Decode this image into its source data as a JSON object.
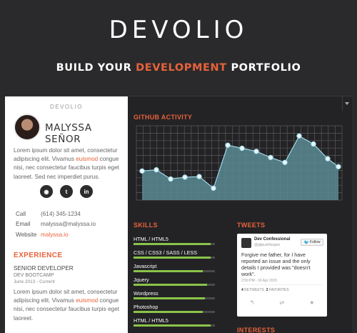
{
  "hero": {
    "title": "DEVOLIO",
    "subtitle_pre": "BUILD YOUR",
    "subtitle_accent": "DEVELOPMENT",
    "subtitle_post": "PORTFOLIO"
  },
  "profile": {
    "brand": "DEVOLIO",
    "name": "MALYSSA SEÑOR",
    "bio_pre": "Lorem ipsum dolor sit amet, consectetur adipiscing elit. Vivamus",
    "bio_highlight": "euismod",
    "bio_post": "congue nisi, nec consectetur faucibus turpis eget laoreet. Sed nec imperdiet purus.",
    "socials": [
      {
        "icon": "github-icon",
        "glyph": "◉"
      },
      {
        "icon": "twitter-icon",
        "glyph": "t"
      },
      {
        "icon": "linkedin-icon",
        "glyph": "in"
      }
    ],
    "contact": {
      "call_label": "Call",
      "call_value": "(614) 345-1234",
      "email_label": "Email",
      "email_value": "malyssa@malyssa.io",
      "website_label": "Website",
      "website_value": "malyssa.io"
    }
  },
  "experience": {
    "heading": "EXPERIENCE",
    "title": "SENIOR DEVELOPER",
    "company": "DEV BOOTCAMP",
    "date": "June 2013 - Current",
    "desc_pre": "Lorem ipsum dolor sit amet, consectetur adipiscing elit. Vivamus",
    "desc_highlight": "euismod",
    "desc_post": "congue nisi, nec consectetur faucibus turpis eget laoreet."
  },
  "github": {
    "heading": "GITHUB ACTIVITY"
  },
  "chart_data": {
    "type": "area",
    "title": "GITHUB ACTIVITY",
    "values": [
      38,
      40,
      25,
      28,
      29,
      10,
      80,
      75,
      70,
      60,
      52,
      95,
      82,
      58,
      45
    ],
    "ylim": [
      0,
      100
    ],
    "grid": true,
    "fill_color": "#5a8a94",
    "line_color": "#9fd8e8"
  },
  "skills": {
    "heading": "SKILLS",
    "items": [
      {
        "label": "HTML / HTML5",
        "level": 0.95
      },
      {
        "label": "CSS / CSS3 / SASS / LESS",
        "level": 0.95
      },
      {
        "label": "Javascript",
        "level": 0.85
      },
      {
        "label": "Jquery",
        "level": 0.9
      },
      {
        "label": "Wordpress",
        "level": 0.88
      },
      {
        "label": "Photoshop",
        "level": 0.85
      },
      {
        "label": "HTML / HTML5",
        "level": 0.95
      }
    ]
  },
  "tweets": {
    "heading": "TWEETS",
    "name": "Dev Confessional",
    "handle": "@gitpushforgive",
    "follow": "Follow",
    "text": "Forgive me father, for I have reported an issue and the only details I provided was \"doesn't work\".",
    "time": "2:50 PM - 16 Apr 2015",
    "retweets": "4",
    "retweets_label": "RETWEETS",
    "favorites": "2",
    "favorites_label": "FAVORITES"
  },
  "interests": {
    "heading": "INTERESTS"
  },
  "colors": {
    "accent": "#e8623a",
    "skill_bar": "#8bc34a",
    "background": "#2a2a2c"
  }
}
